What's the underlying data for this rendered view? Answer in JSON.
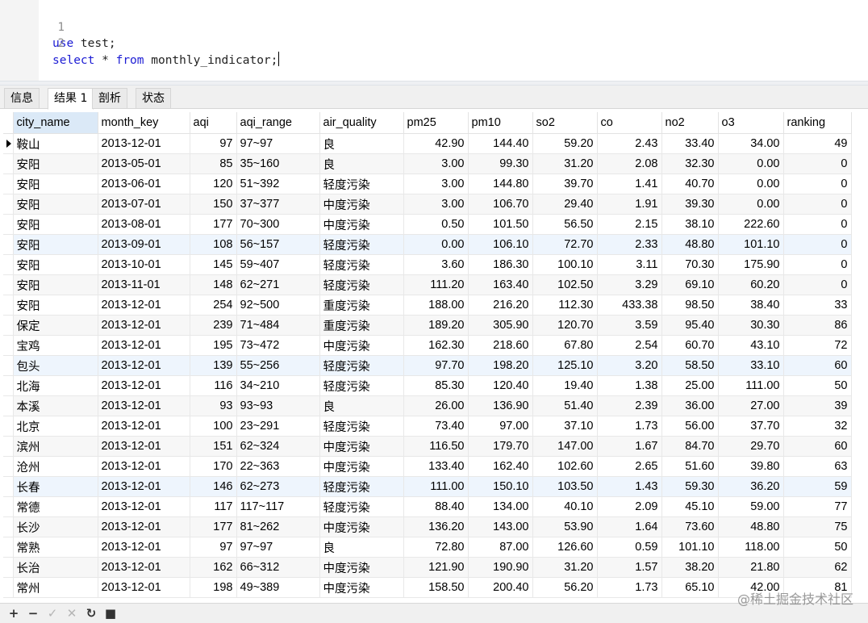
{
  "editor": {
    "lines": [
      {
        "number": "1",
        "keyword": "use",
        "rest": " test;"
      },
      {
        "number": "2",
        "keyword": "select",
        "middle": " * ",
        "keyword2": "from",
        "rest": " monthly_indicator;"
      }
    ]
  },
  "tabs": [
    "信息",
    "结果 1",
    "剖析",
    "状态"
  ],
  "active_tab": "结果 1",
  "grid": {
    "columns": [
      "city_name",
      "month_key",
      "aqi",
      "aqi_range",
      "air_quality",
      "pm25",
      "pm10",
      "so2",
      "co",
      "no2",
      "o3",
      "ranking"
    ],
    "rows": [
      [
        "鞍山",
        "2013-12-01",
        "97",
        "97~97",
        "良",
        "42.90",
        "144.40",
        "59.20",
        "2.43",
        "33.40",
        "34.00",
        "49"
      ],
      [
        "安阳",
        "2013-05-01",
        "85",
        "35~160",
        "良",
        "3.00",
        "99.30",
        "31.20",
        "2.08",
        "32.30",
        "0.00",
        "0"
      ],
      [
        "安阳",
        "2013-06-01",
        "120",
        "51~392",
        "轻度污染",
        "3.00",
        "144.80",
        "39.70",
        "1.41",
        "40.70",
        "0.00",
        "0"
      ],
      [
        "安阳",
        "2013-07-01",
        "150",
        "37~377",
        "中度污染",
        "3.00",
        "106.70",
        "29.40",
        "1.91",
        "39.30",
        "0.00",
        "0"
      ],
      [
        "安阳",
        "2013-08-01",
        "177",
        "70~300",
        "中度污染",
        "0.50",
        "101.50",
        "56.50",
        "2.15",
        "38.10",
        "222.60",
        "0"
      ],
      [
        "安阳",
        "2013-09-01",
        "108",
        "56~157",
        "轻度污染",
        "0.00",
        "106.10",
        "72.70",
        "2.33",
        "48.80",
        "101.10",
        "0"
      ],
      [
        "安阳",
        "2013-10-01",
        "145",
        "59~407",
        "轻度污染",
        "3.60",
        "186.30",
        "100.10",
        "3.11",
        "70.30",
        "175.90",
        "0"
      ],
      [
        "安阳",
        "2013-11-01",
        "148",
        "62~271",
        "轻度污染",
        "111.20",
        "163.40",
        "102.50",
        "3.29",
        "69.10",
        "60.20",
        "0"
      ],
      [
        "安阳",
        "2013-12-01",
        "254",
        "92~500",
        "重度污染",
        "188.00",
        "216.20",
        "112.30",
        "433.38",
        "98.50",
        "38.40",
        "33"
      ],
      [
        "保定",
        "2013-12-01",
        "239",
        "71~484",
        "重度污染",
        "189.20",
        "305.90",
        "120.70",
        "3.59",
        "95.40",
        "30.30",
        "86"
      ],
      [
        "宝鸡",
        "2013-12-01",
        "195",
        "73~472",
        "中度污染",
        "162.30",
        "218.60",
        "67.80",
        "2.54",
        "60.70",
        "43.10",
        "72"
      ],
      [
        "包头",
        "2013-12-01",
        "139",
        "55~256",
        "轻度污染",
        "97.70",
        "198.20",
        "125.10",
        "3.20",
        "58.50",
        "33.10",
        "60"
      ],
      [
        "北海",
        "2013-12-01",
        "116",
        "34~210",
        "轻度污染",
        "85.30",
        "120.40",
        "19.40",
        "1.38",
        "25.00",
        "111.00",
        "50"
      ],
      [
        "本溪",
        "2013-12-01",
        "93",
        "93~93",
        "良",
        "26.00",
        "136.90",
        "51.40",
        "2.39",
        "36.00",
        "27.00",
        "39"
      ],
      [
        "北京",
        "2013-12-01",
        "100",
        "23~291",
        "轻度污染",
        "73.40",
        "97.00",
        "37.10",
        "1.73",
        "56.00",
        "37.70",
        "32"
      ],
      [
        "滨州",
        "2013-12-01",
        "151",
        "62~324",
        "中度污染",
        "116.50",
        "179.70",
        "147.00",
        "1.67",
        "84.70",
        "29.70",
        "60"
      ],
      [
        "沧州",
        "2013-12-01",
        "170",
        "22~363",
        "中度污染",
        "133.40",
        "162.40",
        "102.60",
        "2.65",
        "51.60",
        "39.80",
        "63"
      ],
      [
        "长春",
        "2013-12-01",
        "146",
        "62~273",
        "轻度污染",
        "111.00",
        "150.10",
        "103.50",
        "1.43",
        "59.30",
        "36.20",
        "59"
      ],
      [
        "常德",
        "2013-12-01",
        "117",
        "117~117",
        "轻度污染",
        "88.40",
        "134.00",
        "40.10",
        "2.09",
        "45.10",
        "59.00",
        "77"
      ],
      [
        "长沙",
        "2013-12-01",
        "177",
        "81~262",
        "中度污染",
        "136.20",
        "143.00",
        "53.90",
        "1.64",
        "73.60",
        "48.80",
        "75"
      ],
      [
        "常熟",
        "2013-12-01",
        "97",
        "97~97",
        "良",
        "72.80",
        "87.00",
        "126.60",
        "0.59",
        "101.10",
        "118.00",
        "50"
      ],
      [
        "长治",
        "2013-12-01",
        "162",
        "66~312",
        "中度污染",
        "121.90",
        "190.90",
        "31.20",
        "1.57",
        "38.20",
        "21.80",
        "62"
      ],
      [
        "常州",
        "2013-12-01",
        "198",
        "49~389",
        "中度污染",
        "158.50",
        "200.40",
        "56.20",
        "1.73",
        "65.10",
        "42.00",
        "81"
      ]
    ]
  },
  "toolbar": {
    "buttons": [
      {
        "icon": "plus-icon",
        "glyph": "+",
        "enabled": true
      },
      {
        "icon": "minus-icon",
        "glyph": "−",
        "enabled": true
      },
      {
        "icon": "check-icon",
        "glyph": "✓",
        "enabled": false
      },
      {
        "icon": "cancel-x-icon",
        "glyph": "✕",
        "enabled": false
      },
      {
        "icon": "refresh-icon",
        "glyph": "↻",
        "enabled": true
      },
      {
        "icon": "stop-icon",
        "glyph": "■",
        "enabled": true
      }
    ]
  },
  "watermark": "@稀土掘金技术社区"
}
